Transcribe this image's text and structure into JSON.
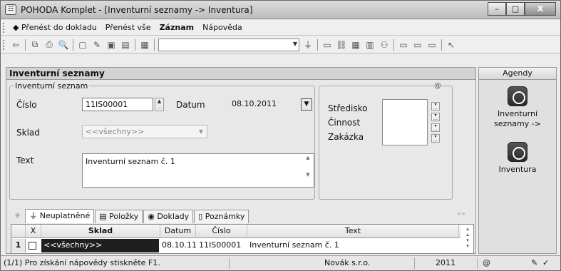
{
  "window": {
    "title": "POHODA Komplet - [Inventurní seznamy -> Inventura]",
    "app_icon": "pohoda-app-icon",
    "min_label": "–",
    "max_label": "□",
    "close_label": "X"
  },
  "menu": {
    "items": [
      {
        "label": "Přenést do dokladu",
        "icon": "back-arrow-icon"
      },
      {
        "label": "Přenést vše"
      },
      {
        "label": "Záznam",
        "bold": true
      },
      {
        "label": "Nápověda"
      }
    ]
  },
  "toolbar": {
    "combo_value": ""
  },
  "panel": {
    "title": "Inventurní seznamy",
    "group_label": "Inventurní seznam",
    "at_symbol": "@",
    "cislo_label": "Číslo",
    "cislo_value": "11IS00001",
    "datum_label": "Datum",
    "datum_value": "08.10.2011",
    "sklad_label": "Sklad",
    "sklad_value": "<<všechny>>",
    "text_label": "Text",
    "text_value": "Inventurní seznam č. 1",
    "stredisko_label": "Středisko",
    "cinnost_label": "Činnost",
    "zakazka_label": "Zakázka"
  },
  "tabs": [
    {
      "label": "Neuplatněné",
      "icon": "filter-icon"
    },
    {
      "label": "Položky",
      "icon": "list-icon"
    },
    {
      "label": "Doklady",
      "icon": "documents-icon"
    },
    {
      "label": "Poznámky",
      "icon": "note-icon"
    }
  ],
  "grid": {
    "columns": [
      "X",
      "Sklad",
      "Datum",
      "Číslo",
      "Text"
    ],
    "rows": [
      {
        "num": "1",
        "x": "",
        "sklad": "<<všechny>>",
        "datum": "08.10.11",
        "cislo": "11IS00001",
        "text": "Inventurní seznam č. 1"
      }
    ]
  },
  "agendy": {
    "header": "Agendy",
    "items": [
      {
        "label_line1": "Inventurní",
        "label_line2": "seznamy ->"
      },
      {
        "label_line1": "Inventura",
        "label_line2": ""
      }
    ]
  },
  "statusbar": {
    "help": "(1/1) Pro získání nápovědy stiskněte F1.",
    "company": "Novák s.r.o.",
    "year": "2011",
    "at_symbol": "@"
  }
}
